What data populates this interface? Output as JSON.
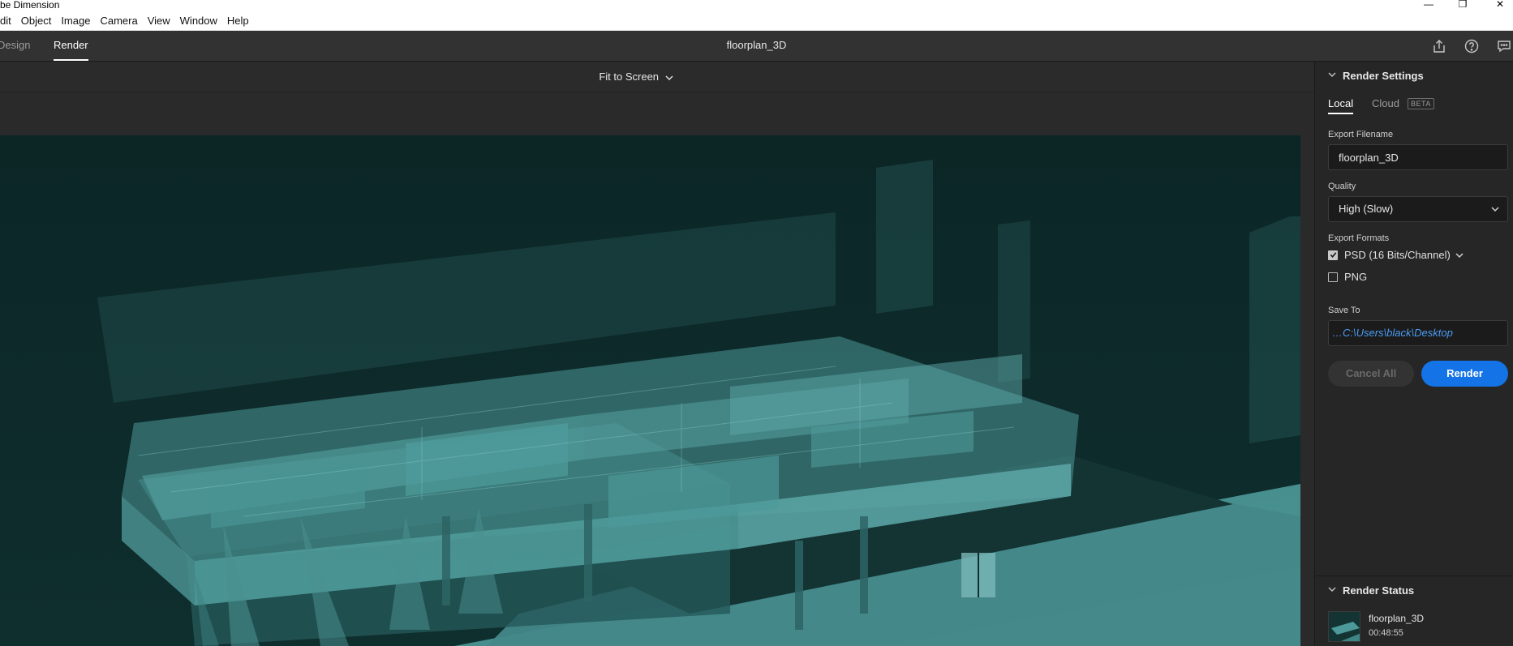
{
  "window": {
    "title": "be Dimension",
    "minimize": "—",
    "restore": "❐",
    "close": "✕"
  },
  "menu": [
    "dit",
    "Object",
    "Image",
    "Camera",
    "View",
    "Window",
    "Help"
  ],
  "header": {
    "tabs": [
      "Design",
      "Render"
    ],
    "active_tab": "Render",
    "doc_title": "floorplan_3D",
    "icons": [
      "share-icon",
      "help-icon",
      "chat-icon"
    ]
  },
  "canvas": {
    "zoom_label": "Fit to Screen",
    "bg_color": "#0e2a2a",
    "model_color": "#4a8a8a"
  },
  "render_settings": {
    "heading": "Render Settings",
    "tabs": {
      "local": "Local",
      "cloud": "Cloud",
      "beta": "BETA"
    },
    "export_filename_label": "Export Filename",
    "export_filename": "floorplan_3D",
    "quality_label": "Quality",
    "quality": "High (Slow)",
    "export_formats_label": "Export Formats",
    "formats": [
      {
        "label": "PSD (16 Bits/Channel)",
        "checked": true
      },
      {
        "label": "PNG",
        "checked": false
      }
    ],
    "save_to_label": "Save To",
    "save_to": "…C:\\Users\\black\\Desktop",
    "cancel_all": "Cancel All",
    "render": "Render",
    "accent": "#1473e6"
  },
  "render_status": {
    "heading": "Render Status",
    "item_name": "floorplan_3D",
    "item_time": "00:48:55"
  }
}
